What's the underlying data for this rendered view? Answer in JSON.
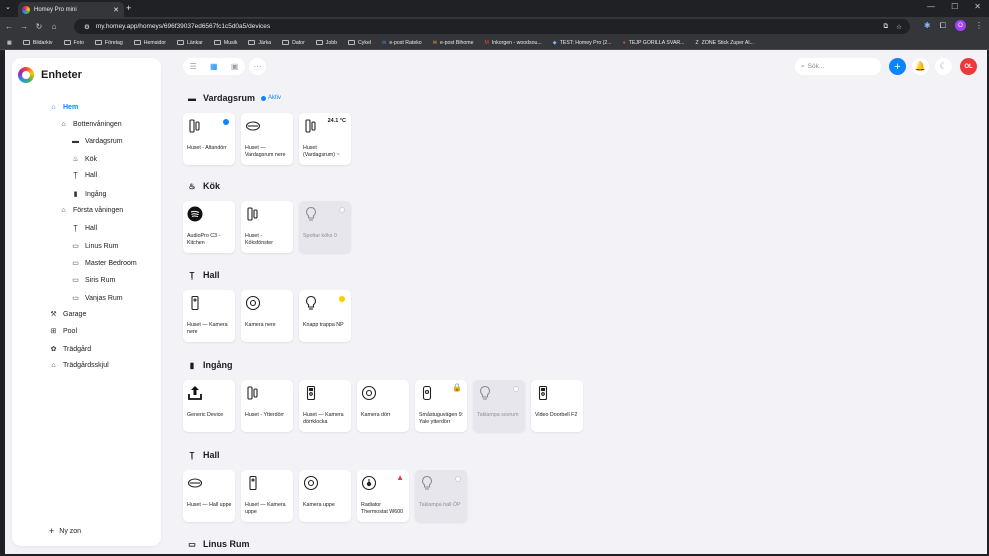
{
  "browser": {
    "tab_title": "Homey Pro mini",
    "url": "my.homey.app/homeys/696f39037ed6567fc1c5d0a5/devices",
    "profile_initial": "O",
    "bookmarks": [
      "Bildarkiv",
      "Foto",
      "Företag",
      "Hemsidor",
      "Länkar",
      "Musik",
      "Järka",
      "Dator",
      "Jobb",
      "Cykel",
      "e-post Rateko",
      "e-post Bihome",
      "Inkorgen - woodsou...",
      "TEST: Homey Pro (2...",
      "TEJP GORILLA SVAR...",
      "ZONE Stick Zuper Al..."
    ]
  },
  "app": {
    "title": "Enheter",
    "search_placeholder": "Sök...",
    "user_initials": "OL",
    "new_zone": "Ny zon",
    "accent": "#0a84ff",
    "zones": [
      {
        "label": "Hem",
        "icon": "home-icon",
        "active": true
      },
      {
        "label": "Bottenvåningen",
        "icon": "floor-icon"
      },
      {
        "label": "Vardagsrum",
        "icon": "sofa-icon"
      },
      {
        "label": "Kök",
        "icon": "pot-icon"
      },
      {
        "label": "Hall",
        "icon": "lamp-icon"
      },
      {
        "label": "Ingång",
        "icon": "door-icon"
      },
      {
        "label": "Första våningen",
        "icon": "floor-icon"
      },
      {
        "label": "Hall",
        "icon": "lamp-icon"
      },
      {
        "label": "Linus Rum",
        "icon": "bed-icon"
      },
      {
        "label": "Master Bedroom",
        "icon": "bed-icon"
      },
      {
        "label": "Siris Rum",
        "icon": "bed-icon"
      },
      {
        "label": "Vanjas Rum",
        "icon": "bed-icon"
      },
      {
        "label": "Garage",
        "icon": "tools-icon"
      },
      {
        "label": "Pool",
        "icon": "ladder-icon"
      },
      {
        "label": "Trädgård",
        "icon": "flower-icon"
      },
      {
        "label": "Trädgårdsskjul",
        "icon": "shed-icon"
      }
    ]
  },
  "sections": [
    {
      "title": "Vardagsrum",
      "icon": "sofa-icon",
      "status": "Aktiv",
      "devices": [
        {
          "name": "Huset - Altandörr",
          "icon": "contact-sensor-icon",
          "dot": "#0a84ff"
        },
        {
          "name": "Huset — Vardagsrum nere",
          "icon": "smoke-detector-icon"
        },
        {
          "name": "Huset (Vardagsrum) ~",
          "icon": "contact-sensor-icon",
          "value": "24.1 °C"
        }
      ]
    },
    {
      "title": "Kök",
      "icon": "pot-icon",
      "devices": [
        {
          "name": "AudioPro C3 - Kitchen",
          "icon": "spotify-icon"
        },
        {
          "name": "Huset - Köksfönster",
          "icon": "contact-sensor-icon"
        },
        {
          "name": "Spottar köks 0",
          "icon": "bulb-icon",
          "off": true,
          "dot": "#ffffff"
        }
      ]
    },
    {
      "title": "Hall",
      "icon": "lamp-icon",
      "devices": [
        {
          "name": "Huset — Kamera nere",
          "icon": "motion-sensor-icon"
        },
        {
          "name": "Kamera nere",
          "icon": "camera-icon"
        },
        {
          "name": "Knapp trappa NP",
          "icon": "bulb-icon",
          "dot": "#ffcc00"
        }
      ]
    },
    {
      "title": "Ingång",
      "icon": "door-icon",
      "devices": [
        {
          "name": "Generic Device",
          "icon": "upload-icon"
        },
        {
          "name": "Huset - Ytterdörr",
          "icon": "contact-sensor-icon"
        },
        {
          "name": "Huset — Kamera dörrklocka",
          "icon": "doorbell-icon"
        },
        {
          "name": "Kamera dörr",
          "icon": "camera-icon"
        },
        {
          "name": "Småstuguvägen 9: Yale ytterdörr",
          "icon": "lock-icon",
          "warn": "lock"
        },
        {
          "name": "Taklampa sovrum",
          "icon": "bulb-icon",
          "off": true,
          "dot": "#ffffff"
        },
        {
          "name": "Video Doorbell F2",
          "icon": "doorbell-icon"
        }
      ]
    },
    {
      "title": "Hall",
      "icon": "lamp-icon",
      "devices": [
        {
          "name": "Huset — Hall uppe",
          "icon": "smoke-detector-icon"
        },
        {
          "name": "Huset — Kamera uppe",
          "icon": "motion-sensor-icon"
        },
        {
          "name": "Kamera uppe",
          "icon": "camera-icon"
        },
        {
          "name": "Radiator Thermostat W600",
          "icon": "thermostat-icon",
          "warn": "alert"
        },
        {
          "name": "Taklampa hall ÖP",
          "icon": "bulb-icon",
          "off": true,
          "dot": "#ffffff"
        }
      ]
    },
    {
      "title": "Linus Rum",
      "icon": "bed-icon",
      "devices": []
    }
  ]
}
